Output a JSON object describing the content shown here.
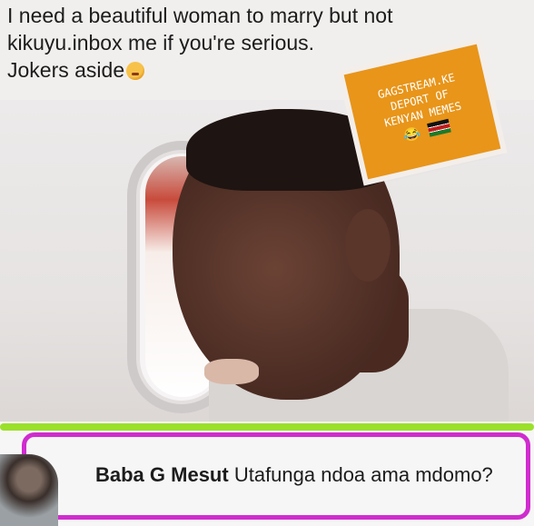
{
  "post": {
    "line1": "I need a beautiful woman to marry but not",
    "line2": "kikuyu.inbox me if you're serious.",
    "line3": "Jokers aside"
  },
  "sticker": {
    "line1": "GAGSTREAM.KE",
    "line2": "DEPORT OF",
    "line3": "KENYAN MEMES",
    "emoji": "😂"
  },
  "comment": {
    "author": "Baba G Mesut",
    "text": "Utafunga ndoa ama mdomo?"
  },
  "colors": {
    "highlight_green": "#9be02c",
    "highlight_pink": "#d02ccf",
    "sticker_orange": "#e8951a"
  }
}
